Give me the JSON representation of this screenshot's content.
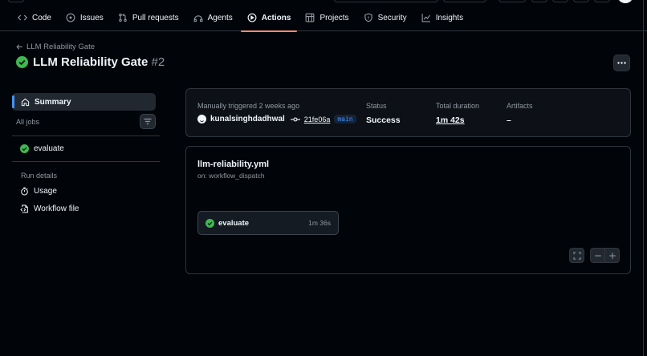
{
  "nav": {
    "items": [
      {
        "label": "Code",
        "icon": "code-icon"
      },
      {
        "label": "Issues",
        "icon": "issue-opened-icon"
      },
      {
        "label": "Pull requests",
        "icon": "git-pull-request-icon"
      },
      {
        "label": "Agents",
        "icon": "agent-icon"
      },
      {
        "label": "Actions",
        "icon": "play-icon",
        "active": true
      },
      {
        "label": "Projects",
        "icon": "table-icon"
      },
      {
        "label": "Security",
        "icon": "shield-icon"
      },
      {
        "label": "Insights",
        "icon": "graph-icon"
      }
    ]
  },
  "header": {
    "back_label": "LLM Reliability Gate",
    "title": "LLM Reliability Gate",
    "run_number": "#2",
    "status_icon": "check-circle-fill-icon"
  },
  "sidebar": {
    "summary_label": "Summary",
    "all_jobs_label": "All jobs",
    "jobs": [
      {
        "label": "evaluate",
        "status": "success"
      }
    ],
    "run_details_heading": "Run details",
    "links": [
      {
        "label": "Usage",
        "icon": "stopwatch-icon"
      },
      {
        "label": "Workflow file",
        "icon": "file-code-icon"
      }
    ]
  },
  "summary": {
    "trigger_text": "Manually triggered 2 weeks ago",
    "username": "kunalsinghdadhwal",
    "commit_sha": "21fe06a",
    "branch": "main",
    "status_label": "Status",
    "status_value": "Success",
    "duration_label": "Total duration",
    "duration_value": "1m 42s",
    "artifacts_label": "Artifacts",
    "artifacts_value": "–"
  },
  "workflow": {
    "file_name": "llm-reliability.yml",
    "trigger": "on: workflow_dispatch",
    "job": {
      "name": "evaluate",
      "duration": "1m 36s"
    }
  },
  "colors": {
    "success": "#3fb950",
    "active_underline": "#fd8c73",
    "accent": "#4493f8"
  }
}
